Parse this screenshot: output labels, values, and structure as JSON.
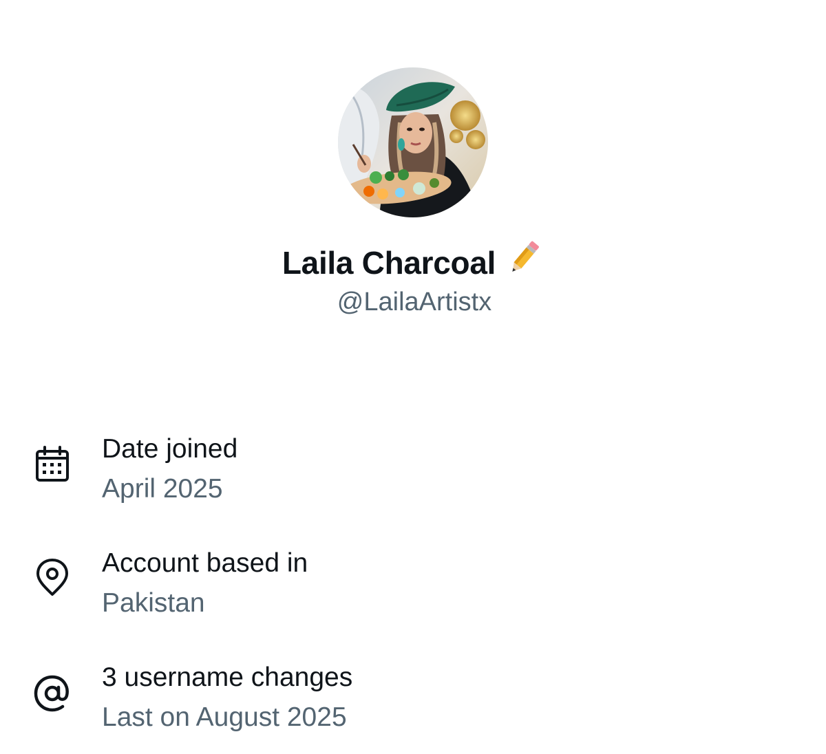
{
  "profile": {
    "display_name": "Laila Charcoal",
    "name_emoji": "pencil-icon",
    "handle": "@LailaArtistx",
    "avatar": "avatar"
  },
  "about": {
    "items": [
      {
        "icon": "calendar-icon",
        "label": "Date joined",
        "value": "April 2025"
      },
      {
        "icon": "location-pin-icon",
        "label": "Account based in",
        "value": "Pakistan"
      },
      {
        "icon": "at-sign-icon",
        "label": "3 username changes",
        "value": "Last on August 2025"
      }
    ]
  },
  "colors": {
    "primary_text": "#0f1419",
    "secondary_text": "#536471",
    "background": "#ffffff"
  }
}
